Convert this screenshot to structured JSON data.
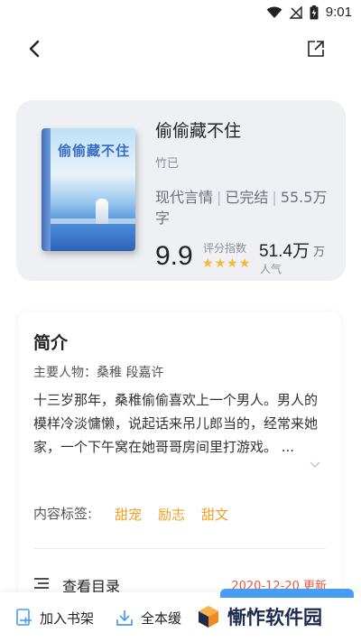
{
  "status_bar": {
    "time": "9:01"
  },
  "book": {
    "cover_title": "偷偷藏不住",
    "title": "偷偷藏不住",
    "author": "竹已",
    "genre": "现代言情",
    "status": "已完结",
    "word_count": "55.5万字",
    "score": "9.9",
    "score_label": "评分指数",
    "rating_stars": 4,
    "popularity": "51.4万",
    "popularity_unit": "万",
    "popularity_label": "人气"
  },
  "intro": {
    "title": "简介",
    "characters": "主要人物：桑稚 段嘉许",
    "text": "十三岁那年，桑稚偷偷喜欢上一个男人。男人的模样冷淡慵懒，说起话来吊儿郎当的，经常来她家，一个下午窝在她哥哥房间里打游戏。 ...",
    "tags_label": "内容标签:",
    "tags": [
      "甜宠",
      "励志",
      "甜文"
    ],
    "catalog_label": "查看目录",
    "catalog_date": "2020-12-20 更新"
  },
  "bottom_bar": {
    "add_shelf": "加入书架",
    "download": "全本缓",
    "watermark": "慚怍软件园"
  },
  "colors": {
    "accent": "#f0a020",
    "card_bg": "#eef0f4",
    "star": "#f5b82e",
    "update_red": "#e85a3c",
    "primary_blue": "#4a9cf2"
  }
}
